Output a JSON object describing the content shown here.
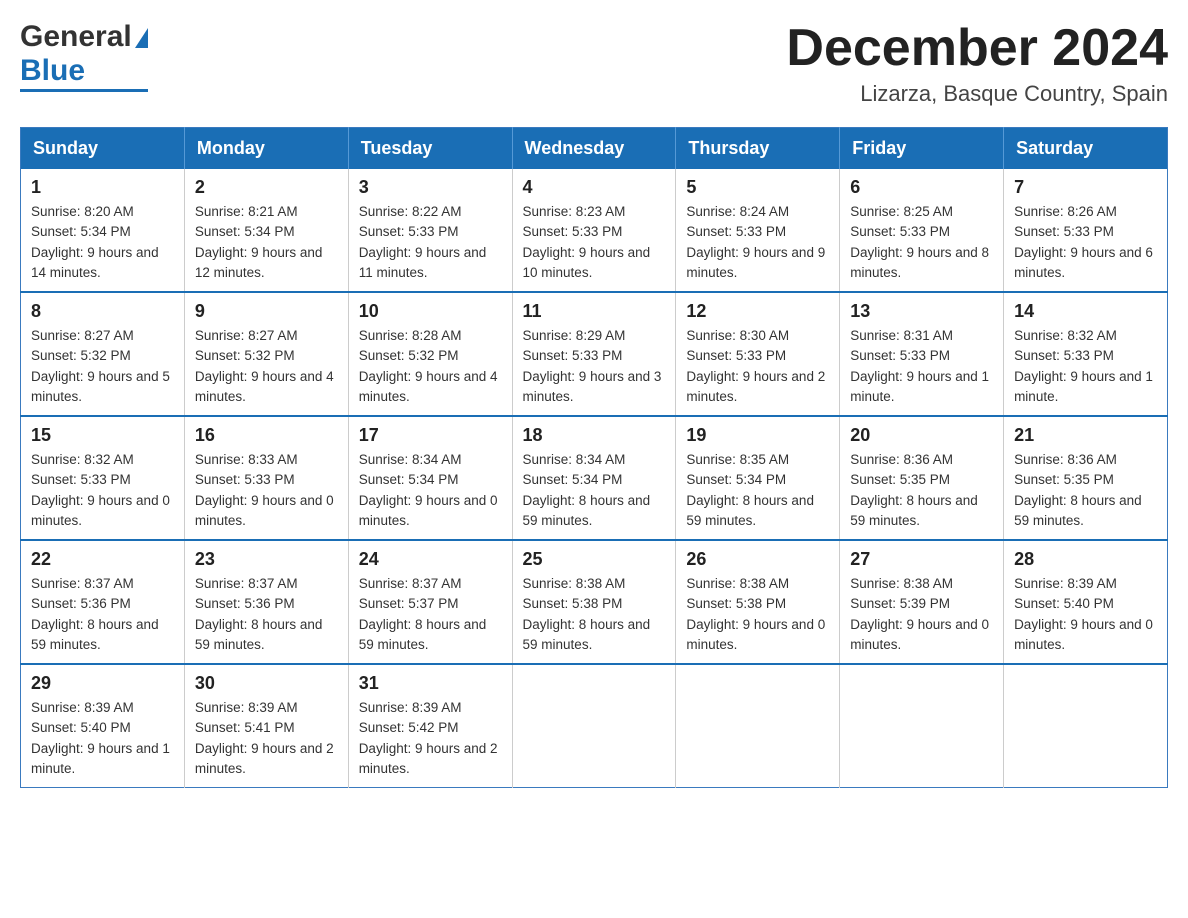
{
  "header": {
    "logo_general": "General",
    "logo_blue": "Blue",
    "main_title": "December 2024",
    "subtitle": "Lizarza, Basque Country, Spain"
  },
  "calendar": {
    "days_of_week": [
      "Sunday",
      "Monday",
      "Tuesday",
      "Wednesday",
      "Thursday",
      "Friday",
      "Saturday"
    ],
    "weeks": [
      [
        {
          "day": "1",
          "sunrise": "8:20 AM",
          "sunset": "5:34 PM",
          "daylight": "9 hours and 14 minutes."
        },
        {
          "day": "2",
          "sunrise": "8:21 AM",
          "sunset": "5:34 PM",
          "daylight": "9 hours and 12 minutes."
        },
        {
          "day": "3",
          "sunrise": "8:22 AM",
          "sunset": "5:33 PM",
          "daylight": "9 hours and 11 minutes."
        },
        {
          "day": "4",
          "sunrise": "8:23 AM",
          "sunset": "5:33 PM",
          "daylight": "9 hours and 10 minutes."
        },
        {
          "day": "5",
          "sunrise": "8:24 AM",
          "sunset": "5:33 PM",
          "daylight": "9 hours and 9 minutes."
        },
        {
          "day": "6",
          "sunrise": "8:25 AM",
          "sunset": "5:33 PM",
          "daylight": "9 hours and 8 minutes."
        },
        {
          "day": "7",
          "sunrise": "8:26 AM",
          "sunset": "5:33 PM",
          "daylight": "9 hours and 6 minutes."
        }
      ],
      [
        {
          "day": "8",
          "sunrise": "8:27 AM",
          "sunset": "5:32 PM",
          "daylight": "9 hours and 5 minutes."
        },
        {
          "day": "9",
          "sunrise": "8:27 AM",
          "sunset": "5:32 PM",
          "daylight": "9 hours and 4 minutes."
        },
        {
          "day": "10",
          "sunrise": "8:28 AM",
          "sunset": "5:32 PM",
          "daylight": "9 hours and 4 minutes."
        },
        {
          "day": "11",
          "sunrise": "8:29 AM",
          "sunset": "5:33 PM",
          "daylight": "9 hours and 3 minutes."
        },
        {
          "day": "12",
          "sunrise": "8:30 AM",
          "sunset": "5:33 PM",
          "daylight": "9 hours and 2 minutes."
        },
        {
          "day": "13",
          "sunrise": "8:31 AM",
          "sunset": "5:33 PM",
          "daylight": "9 hours and 1 minute."
        },
        {
          "day": "14",
          "sunrise": "8:32 AM",
          "sunset": "5:33 PM",
          "daylight": "9 hours and 1 minute."
        }
      ],
      [
        {
          "day": "15",
          "sunrise": "8:32 AM",
          "sunset": "5:33 PM",
          "daylight": "9 hours and 0 minutes."
        },
        {
          "day": "16",
          "sunrise": "8:33 AM",
          "sunset": "5:33 PM",
          "daylight": "9 hours and 0 minutes."
        },
        {
          "day": "17",
          "sunrise": "8:34 AM",
          "sunset": "5:34 PM",
          "daylight": "9 hours and 0 minutes."
        },
        {
          "day": "18",
          "sunrise": "8:34 AM",
          "sunset": "5:34 PM",
          "daylight": "8 hours and 59 minutes."
        },
        {
          "day": "19",
          "sunrise": "8:35 AM",
          "sunset": "5:34 PM",
          "daylight": "8 hours and 59 minutes."
        },
        {
          "day": "20",
          "sunrise": "8:36 AM",
          "sunset": "5:35 PM",
          "daylight": "8 hours and 59 minutes."
        },
        {
          "day": "21",
          "sunrise": "8:36 AM",
          "sunset": "5:35 PM",
          "daylight": "8 hours and 59 minutes."
        }
      ],
      [
        {
          "day": "22",
          "sunrise": "8:37 AM",
          "sunset": "5:36 PM",
          "daylight": "8 hours and 59 minutes."
        },
        {
          "day": "23",
          "sunrise": "8:37 AM",
          "sunset": "5:36 PM",
          "daylight": "8 hours and 59 minutes."
        },
        {
          "day": "24",
          "sunrise": "8:37 AM",
          "sunset": "5:37 PM",
          "daylight": "8 hours and 59 minutes."
        },
        {
          "day": "25",
          "sunrise": "8:38 AM",
          "sunset": "5:38 PM",
          "daylight": "8 hours and 59 minutes."
        },
        {
          "day": "26",
          "sunrise": "8:38 AM",
          "sunset": "5:38 PM",
          "daylight": "9 hours and 0 minutes."
        },
        {
          "day": "27",
          "sunrise": "8:38 AM",
          "sunset": "5:39 PM",
          "daylight": "9 hours and 0 minutes."
        },
        {
          "day": "28",
          "sunrise": "8:39 AM",
          "sunset": "5:40 PM",
          "daylight": "9 hours and 0 minutes."
        }
      ],
      [
        {
          "day": "29",
          "sunrise": "8:39 AM",
          "sunset": "5:40 PM",
          "daylight": "9 hours and 1 minute."
        },
        {
          "day": "30",
          "sunrise": "8:39 AM",
          "sunset": "5:41 PM",
          "daylight": "9 hours and 2 minutes."
        },
        {
          "day": "31",
          "sunrise": "8:39 AM",
          "sunset": "5:42 PM",
          "daylight": "9 hours and 2 minutes."
        },
        null,
        null,
        null,
        null
      ]
    ]
  }
}
